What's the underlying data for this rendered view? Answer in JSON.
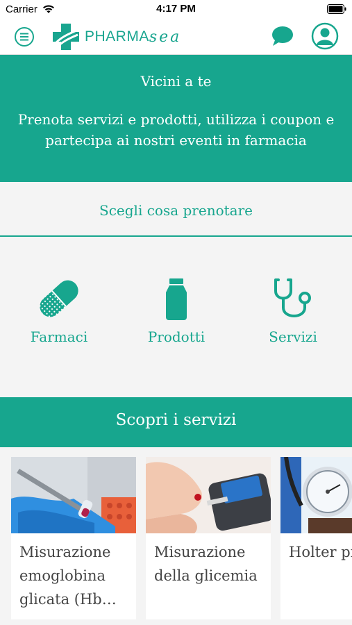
{
  "status_bar": {
    "carrier": "Carrier",
    "time": "4:17 PM"
  },
  "nav": {
    "logo_text": "PHARMA",
    "logo_script": "sea"
  },
  "hero": {
    "title": "Vicini a te",
    "subtitle": "Prenota servizi e prodotti, utilizza i coupon e partecipa ai nostri eventi in farmacia"
  },
  "choose": {
    "label": "Scegli cosa prenotare"
  },
  "categories": [
    {
      "label": "Farmaci",
      "icon": "pill-icon"
    },
    {
      "label": "Prodotti",
      "icon": "bottle-icon"
    },
    {
      "label": "Servizi",
      "icon": "stethoscope-icon"
    }
  ],
  "services_banner": {
    "label": "Scopri i servizi"
  },
  "service_cards": [
    {
      "title": "Misurazione emoglobina glicata (Hb…"
    },
    {
      "title": "Misurazione della glicemia"
    },
    {
      "title": "Holter pressori"
    }
  ],
  "colors": {
    "accent": "#17a68e",
    "background": "#f4f4f4"
  }
}
